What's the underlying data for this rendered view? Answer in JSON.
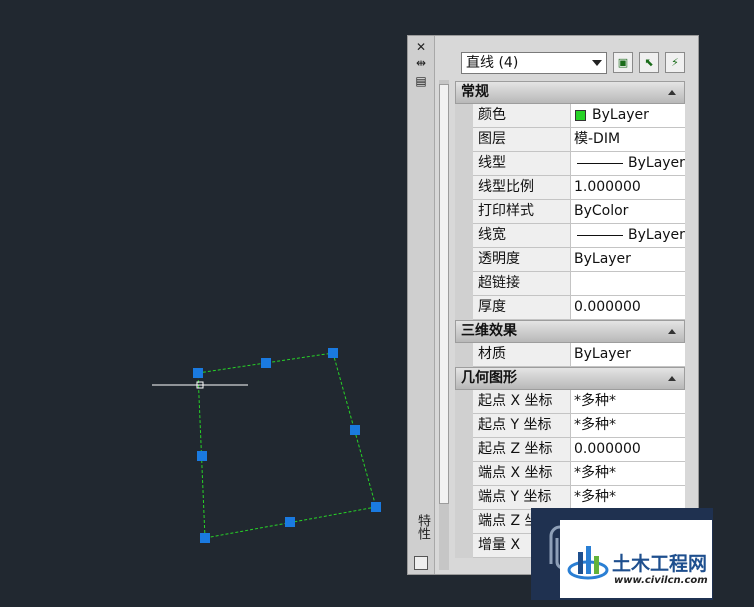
{
  "palette": {
    "title": "特性",
    "selection": "直线 (4)",
    "sections": [
      {
        "title": "常规",
        "rows": [
          {
            "label": "颜色",
            "value": "ByLayer",
            "swatch": "#27d327"
          },
          {
            "label": "图层",
            "value": "模-DIM"
          },
          {
            "label": "线型",
            "value": "ByLayer",
            "line": true
          },
          {
            "label": "线型比例",
            "value": "1.000000"
          },
          {
            "label": "打印样式",
            "value": "ByColor"
          },
          {
            "label": "线宽",
            "value": "ByLayer",
            "line": true
          },
          {
            "label": "透明度",
            "value": "ByLayer"
          },
          {
            "label": "超链接",
            "value": ""
          },
          {
            "label": "厚度",
            "value": "0.000000"
          }
        ]
      },
      {
        "title": "三维效果",
        "rows": [
          {
            "label": "材质",
            "value": "ByLayer"
          }
        ]
      },
      {
        "title": "几何图形",
        "rows": [
          {
            "label": "起点 X 坐标",
            "value": "*多种*"
          },
          {
            "label": "起点 Y 坐标",
            "value": "*多种*"
          },
          {
            "label": "起点 Z 坐标",
            "value": "0.000000"
          },
          {
            "label": "端点 X 坐标",
            "value": "*多种*"
          },
          {
            "label": "端点 Y 坐标",
            "value": "*多种*"
          },
          {
            "label": "端点 Z 坐标",
            "value": ""
          },
          {
            "label": "增量 X",
            "value": ""
          }
        ]
      }
    ]
  },
  "drawing": {
    "line_color": "#27d327",
    "grip_color": "#1a7ae0",
    "crosshair_color": "#ffffff"
  },
  "watermark": {
    "title": "土木工程网",
    "url": "www.civilcn.com"
  }
}
